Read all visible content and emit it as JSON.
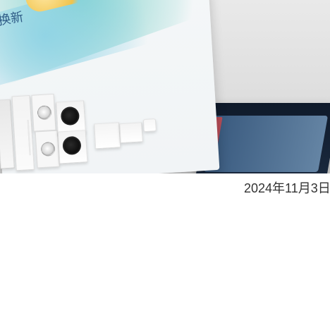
{
  "image": {
    "leaflet_text": "换新",
    "caption": "2024年11月3日"
  },
  "colors": {
    "caption": "#333333",
    "leaflet_text": "#2f5c87",
    "accent_teal": "#5ec7be",
    "accent_gold": "#f0c34c",
    "box_dark": "#0f1a2a"
  }
}
